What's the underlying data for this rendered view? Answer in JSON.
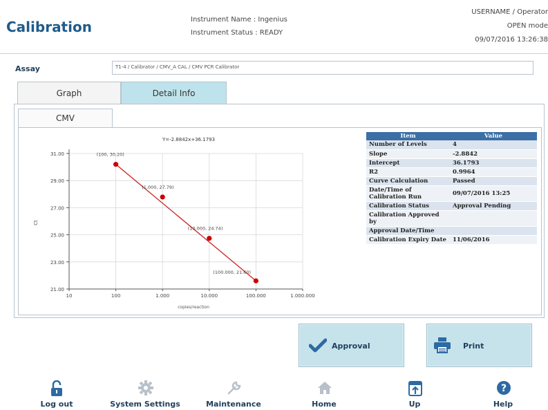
{
  "header": {
    "title": "Calibration",
    "instrument_name": "Instrument Name : Ingenius",
    "instrument_status": "Instrument Status : READY",
    "user": "USERNAME / Operator",
    "mode": "OPEN mode",
    "datetime": "09/07/2016 13:26:38"
  },
  "assay": {
    "label": "Assay",
    "value": "T1-4 / Calibrator / CMV_A CAL / CMV PCR Calibrator"
  },
  "tabs": [
    {
      "label": "Graph",
      "active": false
    },
    {
      "label": "Detail Info",
      "active": true
    }
  ],
  "subtab": {
    "label": "CMV"
  },
  "chart_data": {
    "type": "scatter",
    "title": "Y=-2.8842x+36.1793",
    "xlabel": "copies/reaction",
    "ylabel": "Ct",
    "x_scale": "log",
    "xlim": [
      10,
      1000000
    ],
    "ylim": [
      21,
      31
    ],
    "xticks": [
      "10",
      "100",
      "1.000",
      "10.000",
      "100.000",
      "1.000.000"
    ],
    "yticks": [
      "21.00",
      "23.00",
      "25.00",
      "27.00",
      "29.00",
      "31.00"
    ],
    "grid": true,
    "points": [
      {
        "x": 100,
        "y": 30.2,
        "label": "(100, 30.20)"
      },
      {
        "x": 1000,
        "y": 27.79,
        "label": "(1.000, 27.79)"
      },
      {
        "x": 10000,
        "y": 24.74,
        "label": "(10.000, 24.74)"
      },
      {
        "x": 100000,
        "y": 21.6,
        "label": "(100.000, 21.60)"
      }
    ],
    "line_color": "#cc2222",
    "point_color": "#cc0000"
  },
  "table": {
    "headers": [
      "Item",
      "Value"
    ],
    "rows": [
      {
        "item": "Number of Levels",
        "value": "4"
      },
      {
        "item": "Slope",
        "value": "-2.8842"
      },
      {
        "item": "Intercept",
        "value": "36.1793"
      },
      {
        "item": "R2",
        "value": "0.9964"
      },
      {
        "item": "Curve Calculation",
        "value": "Passed"
      },
      {
        "item": "Date/Time of Calibration Run",
        "value": "09/07/2016 13:25"
      },
      {
        "item": "Calibration Status",
        "value": "Approval Pending"
      },
      {
        "item": "Calibration Approved by",
        "value": ""
      },
      {
        "item": "Approval Date/Time",
        "value": ""
      },
      {
        "item": "Calibration Expiry Date",
        "value": "11/06/2016"
      }
    ]
  },
  "actions": {
    "approval_label": "Approval",
    "print_label": "Print"
  },
  "nav": [
    {
      "label": "Log out",
      "icon": "lock-icon"
    },
    {
      "label": "System Settings",
      "icon": "gear-icon"
    },
    {
      "label": "Maintenance",
      "icon": "wrench-icon"
    },
    {
      "label": "Home",
      "icon": "home-icon"
    },
    {
      "label": "Up",
      "icon": "up-icon"
    },
    {
      "label": "Help",
      "icon": "help-icon"
    }
  ],
  "colors": {
    "brand": "#1f5c8a",
    "tab_active": "#bfe3ec",
    "button": "#c6e3ec",
    "table_header": "#3b6fa6",
    "icon": "#2d5b82"
  }
}
